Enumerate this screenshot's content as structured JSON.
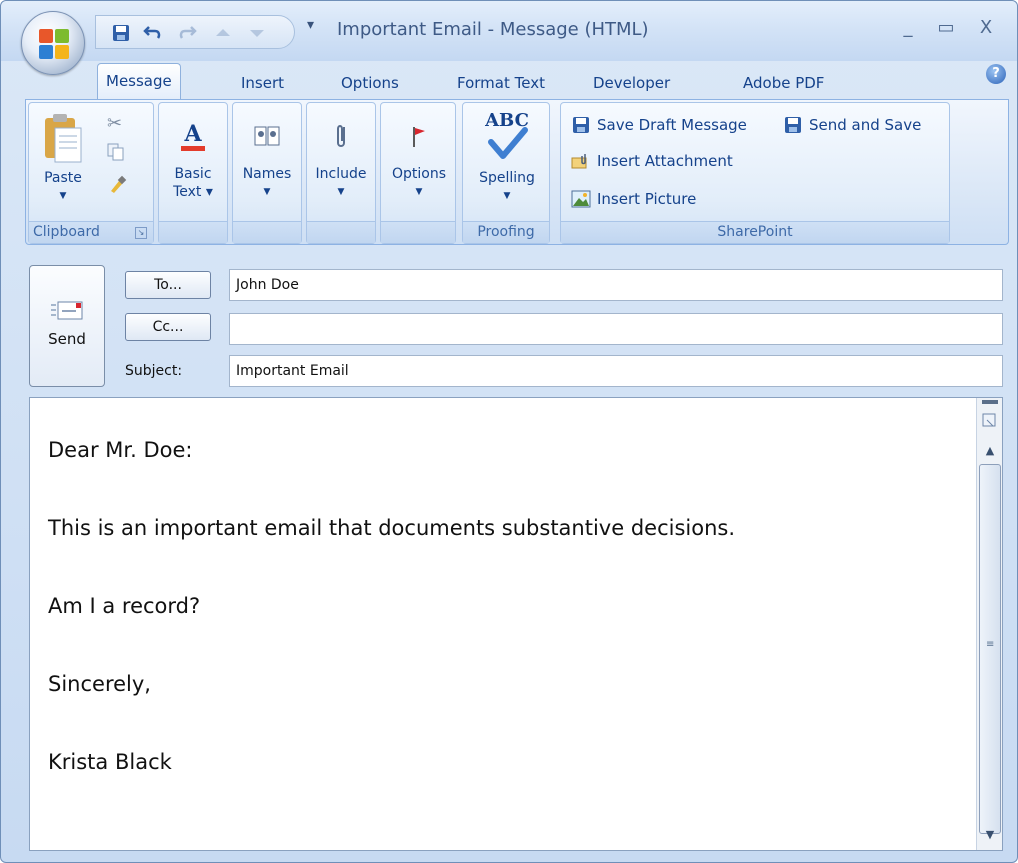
{
  "window": {
    "title": "Important Email - Message (HTML)",
    "minimize": "_",
    "maximize": "▭",
    "close": "X",
    "qat_more": "▾"
  },
  "tabs": [
    {
      "label": "Message",
      "active": true
    },
    {
      "label": "Insert",
      "active": false
    },
    {
      "label": "Options",
      "active": false
    },
    {
      "label": "Format Text",
      "active": false
    },
    {
      "label": "Developer",
      "active": false
    },
    {
      "label": "Adobe PDF",
      "active": false
    }
  ],
  "help": "?",
  "ribbon": {
    "clipboard": {
      "label": "Clipboard",
      "paste": "Paste"
    },
    "basic_text": {
      "line1": "Basic",
      "line2": "Text ▾"
    },
    "names": {
      "label": "Names"
    },
    "include": {
      "label": "Include"
    },
    "options": {
      "label": "Options"
    },
    "proofing": {
      "label": "Proofing",
      "spelling": "Spelling",
      "abc": "ABC"
    },
    "sharepoint": {
      "label": "SharePoint",
      "save_draft": "Save Draft Message",
      "send_and_save": "Send and Save",
      "insert_attachment": "Insert Attachment",
      "insert_picture": "Insert Picture"
    }
  },
  "header": {
    "send": "Send",
    "to_button": "To...",
    "cc_button": "Cc...",
    "subject_label": "Subject:",
    "to_value": "John Doe",
    "cc_value": "",
    "subject_value": "Important Email"
  },
  "body": {
    "paragraphs": [
      "Dear Mr. Doe:",
      "This is an important email that documents substantive decisions.",
      "Am I a record?",
      "Sincerely,",
      "Krista Black"
    ]
  },
  "colors": {
    "accent": "#15428b",
    "ribbon": "#dce8f7",
    "frame": "#c7daf2"
  }
}
